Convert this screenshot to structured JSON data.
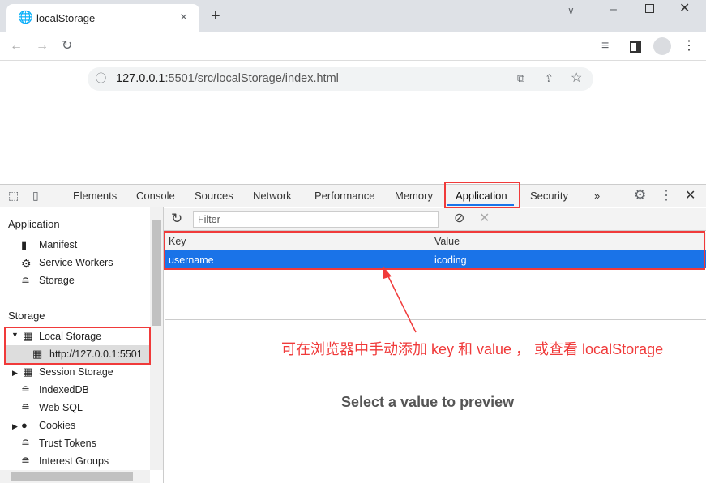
{
  "browser": {
    "tab_title": "localStorage",
    "new_tab": "+",
    "url_host": "127.0.0.1",
    "url_rest": ":5501/src/localStorage/index.html",
    "close_tab": "×"
  },
  "devtools": {
    "tabs": [
      "Elements",
      "Console",
      "Sources",
      "Network",
      "Performance",
      "Memory",
      "Application",
      "Security"
    ],
    "more": "»",
    "active_tab": "Application"
  },
  "sidebar": {
    "app_heading": "Application",
    "app_items": [
      "Manifest",
      "Service Workers",
      "Storage"
    ],
    "storage_heading": "Storage",
    "local_storage": "Local Storage",
    "local_origin": "http://127.0.0.1:5501",
    "storage_items": [
      "Session Storage",
      "IndexedDB",
      "Web SQL",
      "Cookies",
      "Trust Tokens",
      "Interest Groups"
    ]
  },
  "panel": {
    "filter_placeholder": "Filter",
    "columns": [
      "Key",
      "Value"
    ],
    "rows": [
      {
        "key": "username",
        "value": "icoding"
      }
    ],
    "preview": "Select a value to preview"
  },
  "annotation": {
    "text": "可在浏览器中手动添加 key 和 value ， 或查看 localStorage",
    "color": "#f03a3a"
  },
  "colors": {
    "selected_row": "#1a73e8",
    "active_tab_underline": "#1a73e8"
  }
}
